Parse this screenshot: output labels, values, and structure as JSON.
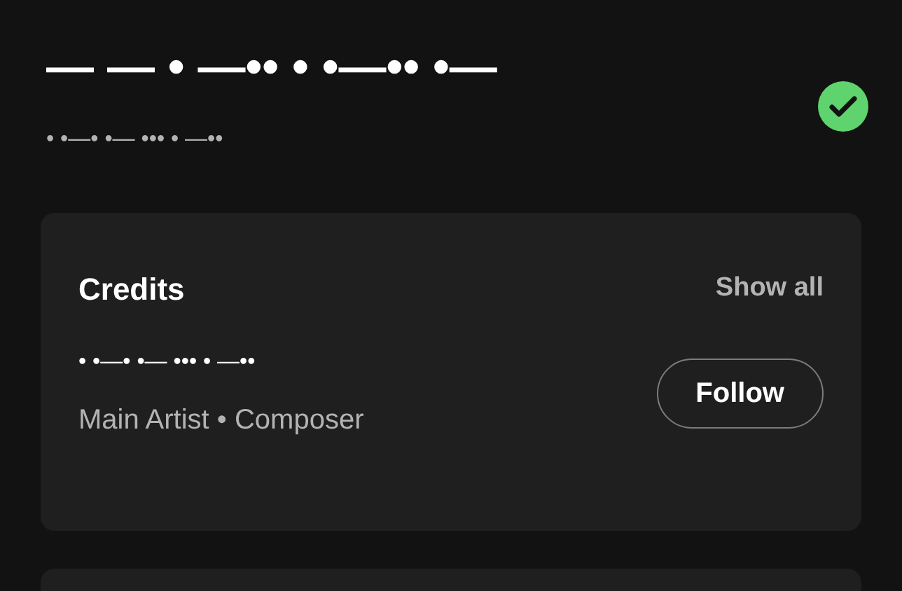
{
  "track": {
    "title": "— — • —•• • •—•• •—",
    "subtitle": "• •—• •— ••• • —••",
    "saved": true
  },
  "credits": {
    "heading": "Credits",
    "show_all": "Show all",
    "artists": [
      {
        "name": "• •—• •— ••• • —••",
        "roles": "Main Artist • Composer",
        "follow": "Follow",
        "following": false
      }
    ]
  }
}
